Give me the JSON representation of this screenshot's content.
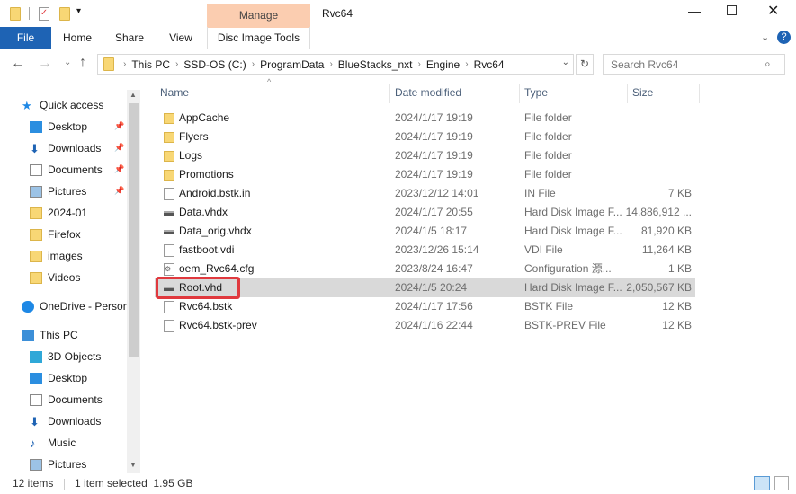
{
  "window": {
    "title": "Rvc64",
    "context_tab": "Manage"
  },
  "ribbon": {
    "tabs": [
      "File",
      "Home",
      "Share",
      "View",
      "Disc Image Tools"
    ]
  },
  "address": {
    "crumbs": [
      "This PC",
      "SSD-OS (C:)",
      "ProgramData",
      "BlueStacks_nxt",
      "Engine",
      "Rvc64"
    ]
  },
  "search": {
    "placeholder": "Search Rvc64"
  },
  "nav": {
    "items": [
      {
        "label": "Quick access",
        "icon": "star-icon",
        "pinned": false,
        "level": 0
      },
      {
        "label": "Desktop",
        "icon": "desktop-icon",
        "pinned": true,
        "level": 1
      },
      {
        "label": "Downloads",
        "icon": "download-icon",
        "pinned": true,
        "level": 1
      },
      {
        "label": "Documents",
        "icon": "documents-icon",
        "pinned": true,
        "level": 1
      },
      {
        "label": "Pictures",
        "icon": "pictures-icon",
        "pinned": true,
        "level": 1
      },
      {
        "label": "2024-01",
        "icon": "folder-icon",
        "pinned": false,
        "level": 1
      },
      {
        "label": "Firefox",
        "icon": "folder-icon",
        "pinned": false,
        "level": 1
      },
      {
        "label": "images",
        "icon": "folder-icon",
        "pinned": false,
        "level": 1
      },
      {
        "label": "Videos",
        "icon": "folder-icon",
        "pinned": false,
        "level": 1
      },
      {
        "label": "OneDrive - Person",
        "icon": "cloud-icon",
        "pinned": false,
        "level": 0
      },
      {
        "label": "This PC",
        "icon": "computer-icon",
        "pinned": false,
        "level": 0
      },
      {
        "label": "3D Objects",
        "icon": "cube-icon",
        "pinned": false,
        "level": 1
      },
      {
        "label": "Desktop",
        "icon": "desktop-icon",
        "pinned": false,
        "level": 1
      },
      {
        "label": "Documents",
        "icon": "documents-icon",
        "pinned": false,
        "level": 1
      },
      {
        "label": "Downloads",
        "icon": "download-icon",
        "pinned": false,
        "level": 1
      },
      {
        "label": "Music",
        "icon": "music-icon",
        "pinned": false,
        "level": 1
      },
      {
        "label": "Pictures",
        "icon": "pictures-icon",
        "pinned": false,
        "level": 1
      }
    ]
  },
  "columns": {
    "name": "Name",
    "date": "Date modified",
    "type": "Type",
    "size": "Size"
  },
  "files": [
    {
      "name": "AppCache",
      "date": "2024/1/17 19:19",
      "type": "File folder",
      "size": "",
      "icon": "folder"
    },
    {
      "name": "Flyers",
      "date": "2024/1/17 19:19",
      "type": "File folder",
      "size": "",
      "icon": "folder"
    },
    {
      "name": "Logs",
      "date": "2024/1/17 19:19",
      "type": "File folder",
      "size": "",
      "icon": "folder"
    },
    {
      "name": "Promotions",
      "date": "2024/1/17 19:19",
      "type": "File folder",
      "size": "",
      "icon": "folder"
    },
    {
      "name": "Android.bstk.in",
      "date": "2023/12/12 14:01",
      "type": "IN File",
      "size": "7 KB",
      "icon": "doc"
    },
    {
      "name": "Data.vhdx",
      "date": "2024/1/17 20:55",
      "type": "Hard Disk Image F...",
      "size": "14,886,912 ...",
      "icon": "disk"
    },
    {
      "name": "Data_orig.vhdx",
      "date": "2024/1/5 18:17",
      "type": "Hard Disk Image F...",
      "size": "81,920 KB",
      "icon": "disk"
    },
    {
      "name": "fastboot.vdi",
      "date": "2023/12/26 15:14",
      "type": "VDI File",
      "size": "11,264 KB",
      "icon": "doc"
    },
    {
      "name": "oem_Rvc64.cfg",
      "date": "2023/8/24 16:47",
      "type": "Configuration 源...",
      "size": "1 KB",
      "icon": "gear"
    },
    {
      "name": "Root.vhd",
      "date": "2024/1/5 20:24",
      "type": "Hard Disk Image F...",
      "size": "2,050,567 KB",
      "icon": "disk",
      "selected": true
    },
    {
      "name": "Rvc64.bstk",
      "date": "2024/1/17 17:56",
      "type": "BSTK File",
      "size": "12 KB",
      "icon": "doc"
    },
    {
      "name": "Rvc64.bstk-prev",
      "date": "2024/1/16 22:44",
      "type": "BSTK-PREV File",
      "size": "12 KB",
      "icon": "doc"
    }
  ],
  "status": {
    "count": "12 items",
    "selection": "1 item selected  1.95 GB"
  },
  "colors": {
    "accent": "#1e63b4",
    "manage": "#fbcdb0",
    "highlight": "#e0393e",
    "selected_row": "#d9d9d9"
  }
}
